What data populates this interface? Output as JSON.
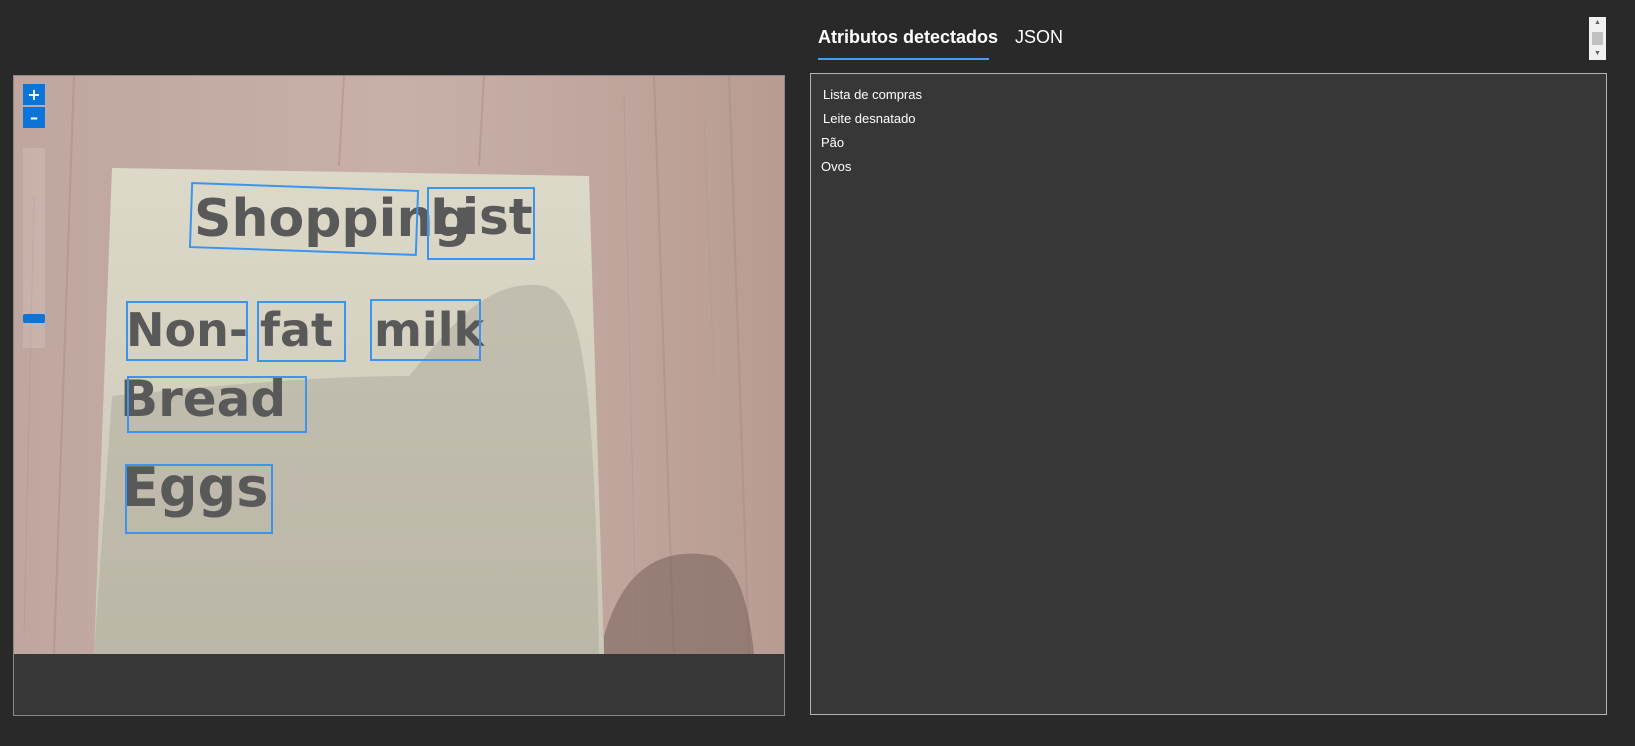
{
  "tabs": [
    {
      "label": "Atributos detectados",
      "active": true
    },
    {
      "label": "JSON",
      "active": false
    }
  ],
  "zoom": {
    "in_label": "+",
    "out_label": "–",
    "level_percent": 13
  },
  "image_words": [
    "Shopping",
    "List",
    "Non-",
    "fat",
    "milk",
    "Bread",
    "Eggs"
  ],
  "results": {
    "lines": [
      "Lista  de compras",
      "Leite  desnatado",
      "Pão",
      "Ovos"
    ]
  },
  "colors": {
    "background": "#292929",
    "panel": "#373737",
    "accent": "#0b74d9",
    "box": "#3b95f0",
    "tab_underline": "#4a9ce8"
  }
}
